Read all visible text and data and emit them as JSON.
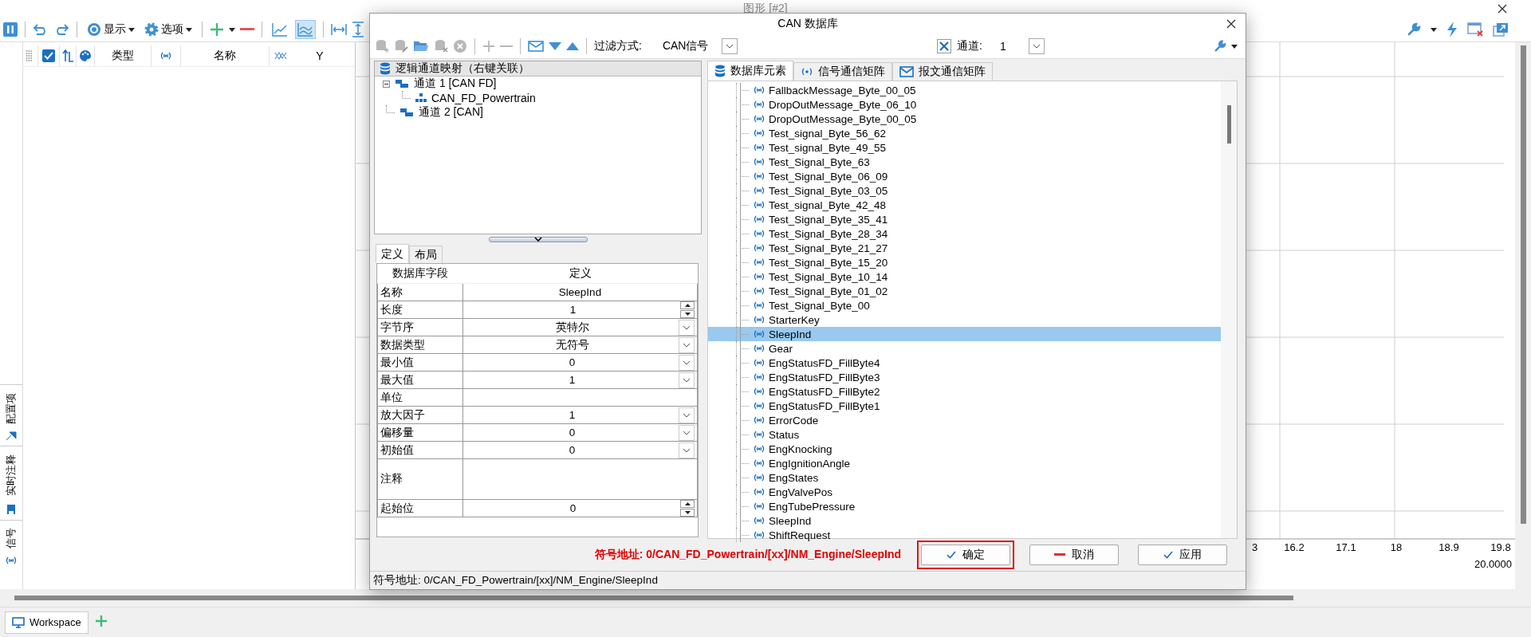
{
  "window": {
    "title": "图形 [#2]"
  },
  "toolbar": {
    "display_label": "显示",
    "options_label": "选项",
    "view_modes": [
      {
        "selected": false
      },
      {
        "selected": true
      }
    ]
  },
  "signal_table": {
    "all_checked": true,
    "columns": [
      {
        "label": "类型"
      },
      {
        "label": "名称"
      },
      {
        "label": "Y"
      }
    ]
  },
  "side_tabs": [
    {
      "label": "配置项"
    },
    {
      "label": "实时注释"
    },
    {
      "label": "信号"
    }
  ],
  "chart": {
    "x_tick_labels": [
      "3",
      "16.2",
      "17.1",
      "18",
      "18.9",
      "19.8"
    ],
    "x_end_label": "20.0000"
  },
  "bottom_tabs": [
    {
      "label": "Workspace",
      "selected": true
    }
  ],
  "dialog": {
    "title": "CAN 数据库",
    "filter_label": "过滤方式:",
    "filter_value": "CAN信号",
    "channel_label": "通道:",
    "channel_value": "1",
    "tree": {
      "header": "逻辑通道映射（右键关联）",
      "items": [
        {
          "label": "通道 1 [CAN FD]",
          "expanded": true,
          "children": [
            {
              "label": "CAN_FD_Powertrain"
            }
          ]
        },
        {
          "label": "通道 2 [CAN]"
        }
      ]
    },
    "detail_tabs": [
      {
        "label": "定义",
        "selected": true
      },
      {
        "label": "布局",
        "selected": false
      }
    ],
    "properties": {
      "columns": [
        "数据库字段",
        "定义"
      ],
      "rows": [
        {
          "field": "名称",
          "value": "SleepInd",
          "kind": "text"
        },
        {
          "field": "长度",
          "value": "1",
          "kind": "spin"
        },
        {
          "field": "字节序",
          "value": "英特尔",
          "kind": "dropdown"
        },
        {
          "field": "数据类型",
          "value": "无符号",
          "kind": "dropdown"
        },
        {
          "field": "最小值",
          "value": "0",
          "kind": "dropdown"
        },
        {
          "field": "最大值",
          "value": "1",
          "kind": "dropdown"
        },
        {
          "field": "单位",
          "kind": "text"
        },
        {
          "field": "放大因子",
          "value": "1",
          "kind": "dropdown"
        },
        {
          "field": "偏移量",
          "value": "0",
          "kind": "dropdown"
        },
        {
          "field": "初始值",
          "value": "0",
          "kind": "dropdown"
        },
        {
          "field": "注释",
          "kind": "note"
        },
        {
          "field": "起始位",
          "value": "0",
          "kind": "spin"
        }
      ]
    },
    "list_tabs": [
      {
        "label": "数据库元素",
        "selected": true
      },
      {
        "label": "信号通信矩阵",
        "selected": false
      },
      {
        "label": "报文通信矩阵",
        "selected": false
      }
    ],
    "signals": [
      {
        "name": "FallbackMessage_Byte_00_05",
        "selected": false
      },
      {
        "name": "DropOutMessage_Byte_06_10",
        "selected": false
      },
      {
        "name": "DropOutMessage_Byte_00_05",
        "selected": false
      },
      {
        "name": "Test_signal_Byte_56_62",
        "selected": false
      },
      {
        "name": "Test_signal_Byte_49_55",
        "selected": false
      },
      {
        "name": "Test_Signal_Byte_63",
        "selected": false
      },
      {
        "name": "Test_Signal_Byte_06_09",
        "selected": false
      },
      {
        "name": "Test_Signal_Byte_03_05",
        "selected": false
      },
      {
        "name": "Test_signal_Byte_42_48",
        "selected": false
      },
      {
        "name": "Test_Signal_Byte_35_41",
        "selected": false
      },
      {
        "name": "Test_Signal_Byte_28_34",
        "selected": false
      },
      {
        "name": "Test_Signal_Byte_21_27",
        "selected": false
      },
      {
        "name": "Test_Signal_Byte_15_20",
        "selected": false
      },
      {
        "name": "Test_Signal_Byte_10_14",
        "selected": false
      },
      {
        "name": "Test_Signal_Byte_01_02",
        "selected": false
      },
      {
        "name": "Test_Signal_Byte_00",
        "selected": false
      },
      {
        "name": "StarterKey",
        "selected": false
      },
      {
        "name": "SleepInd",
        "selected": true
      },
      {
        "name": "Gear",
        "selected": false
      },
      {
        "name": "EngStatusFD_FillByte4",
        "selected": false
      },
      {
        "name": "EngStatusFD_FillByte3",
        "selected": false
      },
      {
        "name": "EngStatusFD_FillByte2",
        "selected": false
      },
      {
        "name": "EngStatusFD_FillByte1",
        "selected": false
      },
      {
        "name": "ErrorCode",
        "selected": false
      },
      {
        "name": "Status",
        "selected": false
      },
      {
        "name": "EngKnocking",
        "selected": false
      },
      {
        "name": "EngIgnitionAngle",
        "selected": false
      },
      {
        "name": "EngStates",
        "selected": false
      },
      {
        "name": "EngValvePos",
        "selected": false
      },
      {
        "name": "EngTubePressure",
        "selected": false
      },
      {
        "name": "SleepInd",
        "selected": false
      },
      {
        "name": "ShiftRequest",
        "selected": false
      }
    ],
    "symbol_address": "符号地址: 0/CAN_FD_Powertrain/[xx]/NM_Engine/SleepInd",
    "buttons": [
      {
        "label": "确定",
        "kind": "ok",
        "highlighted": true
      },
      {
        "label": "取消",
        "kind": "cancel",
        "highlighted": false
      },
      {
        "label": "应用",
        "kind": "apply",
        "highlighted": false
      }
    ],
    "status_bar": "符号地址: 0/CAN_FD_Powertrain/[xx]/NM_Engine/SleepInd"
  }
}
